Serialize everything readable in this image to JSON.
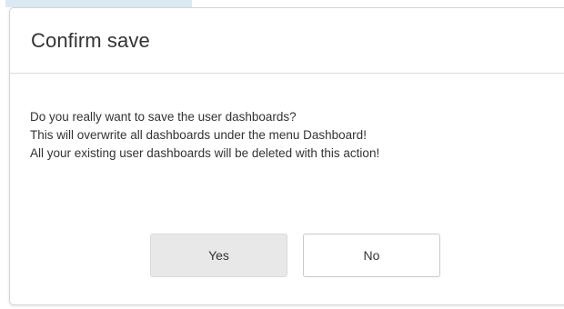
{
  "dialog": {
    "title": "Confirm save",
    "message": [
      "Do you really want to save the user dashboards?",
      "This will overwrite all dashboards under the menu Dashboard!",
      "All your existing user dashboards will be deleted with this action!"
    ],
    "buttons": {
      "yes_label": "Yes",
      "no_label": "No"
    }
  },
  "colors": {
    "text": "#333333",
    "border": "#d4d4d4",
    "yes_button_bg": "#e8e8e8",
    "no_button_bg": "#ffffff",
    "backdrop_accent": "#dbe9f2"
  }
}
